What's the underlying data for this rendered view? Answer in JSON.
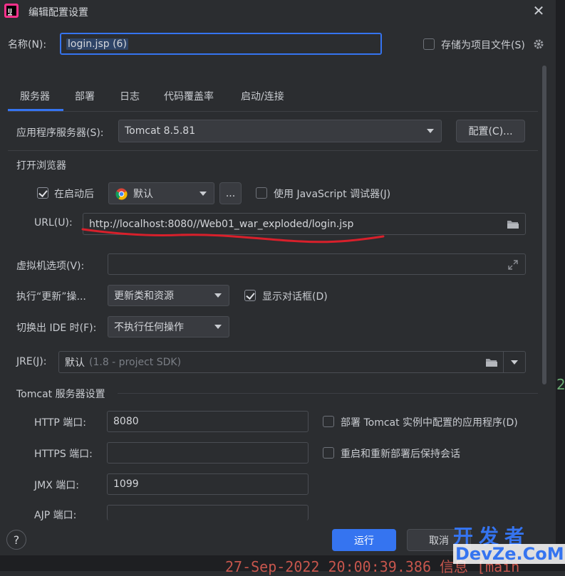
{
  "window": {
    "title": "编辑配置设置"
  },
  "name_row": {
    "label": "名称(N):",
    "value": "login.jsp (6)",
    "store_as_file_label": "存储为项目文件(S)"
  },
  "tabs": [
    {
      "label": "服务器",
      "active": true
    },
    {
      "label": "部署"
    },
    {
      "label": "日志"
    },
    {
      "label": "代码覆盖率"
    },
    {
      "label": "启动/连接"
    }
  ],
  "server": {
    "app_server_label": "应用程序服务器(S):",
    "app_server_value": "Tomcat 8.5.81",
    "configure_button": "配置(C)..."
  },
  "browser": {
    "section_title": "打开浏览器",
    "after_launch_label": "在启动后",
    "after_launch_checked": true,
    "browser_value": "默认",
    "more_button": "...",
    "js_debugger_label": "使用 JavaScript 调试器(J)",
    "js_debugger_checked": false,
    "url_label": "URL(U):",
    "url_value": "http://localhost:8080//Web01_war_exploded/login.jsp"
  },
  "vm": {
    "label": "虚拟机选项(V):",
    "value": ""
  },
  "update": {
    "label": "执行“更新”操...",
    "value": "更新类和资源",
    "show_dialog_label": "显示对话框(D)",
    "show_dialog_checked": true
  },
  "frame_deactivation": {
    "label": "切换出 IDE 时(F):",
    "value": "不执行任何操作"
  },
  "jre": {
    "label": "JRE(J):",
    "value": "默认",
    "hint": "(1.8 - project SDK)"
  },
  "tomcat": {
    "section_title": "Tomcat 服务器设置",
    "http_label": "HTTP 端口:",
    "http_value": "8080",
    "deploy_apps_label": "部署 Tomcat 实例中配置的应用程序(D)",
    "https_label": "HTTPS 端口:",
    "https_value": "",
    "preserve_sessions_label": "重启和重新部署后保持会话",
    "jmx_label": "JMX 端口:",
    "jmx_value": "1099",
    "ajp_label": "AJP 端口:",
    "ajp_value": ""
  },
  "footer": {
    "help": "?",
    "run_button": "运行",
    "cancel_button": "取消"
  },
  "background": {
    "log_text": "27-Sep-2022 20:00:39.386 信息 [main",
    "stray_char": "2"
  },
  "watermark": {
    "cn": "开发者",
    "en": "DevZe.CoM"
  },
  "colors": {
    "accent": "#3574f0",
    "annotation": "#d8202b",
    "background": "#2b2d30"
  }
}
